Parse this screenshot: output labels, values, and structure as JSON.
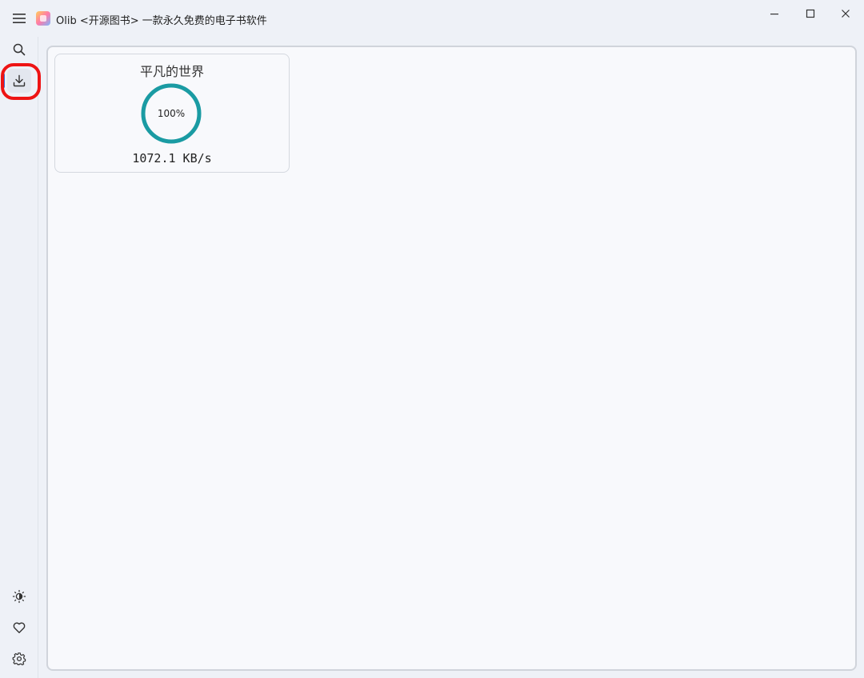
{
  "window": {
    "title": "Olib <开源图书> 一款永久免费的电子书软件",
    "logo_icon": "olib-logo-icon"
  },
  "sidebar": {
    "items": [
      {
        "name": "search",
        "icon": "search-icon"
      },
      {
        "name": "downloads",
        "icon": "download-icon",
        "active": true
      }
    ],
    "bottom_items": [
      {
        "name": "theme",
        "icon": "theme-toggle-icon"
      },
      {
        "name": "favorites",
        "icon": "heart-icon"
      },
      {
        "name": "settings",
        "icon": "gear-icon"
      }
    ]
  },
  "downloads": [
    {
      "title": "平凡的世界",
      "progress_percent": 100,
      "progress_label": "100%",
      "speed": "1072.1 KB/s"
    }
  ],
  "colors": {
    "progress": "#1a9ba3",
    "highlight": "#ee1414",
    "active_indicator": "#3b6dd8"
  }
}
